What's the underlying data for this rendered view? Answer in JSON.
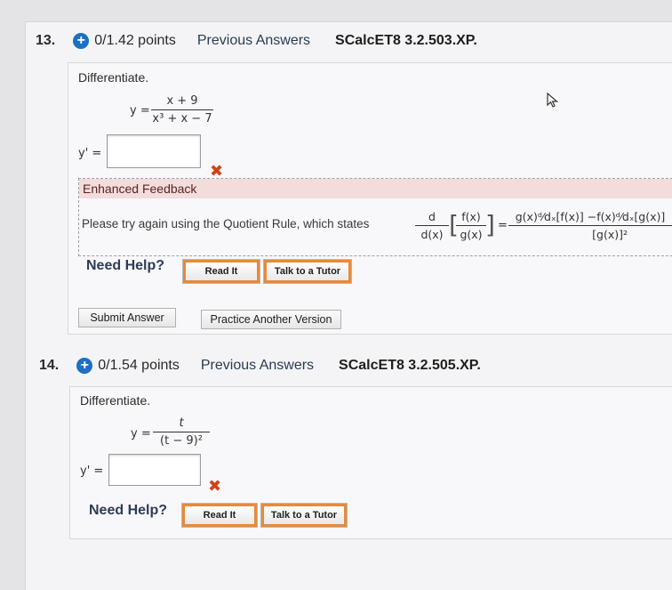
{
  "q13": {
    "number": "13.",
    "points": "0/1.42 points",
    "previous": "Previous Answers",
    "source": "SCalcET8 3.2.503.XP.",
    "instruction": "Differentiate.",
    "y_label": "y =",
    "numerator": "x + 9",
    "denominator": "x³ + x − 7",
    "yprime_label": "y' =",
    "answer": "",
    "feedback_title": "Enhanced Feedback",
    "feedback_text": "Please try again using the Quotient Rule, which states",
    "rule_lhs_num": "d",
    "rule_lhs_den": "d(x)",
    "rule_inner_num": "f(x)",
    "rule_inner_den": "g(x)",
    "rule_eq": "=",
    "rule_rhs_num": "g(x)ᵈ⁄dₓ[f(x)] −f(x)ᵈ⁄dₓ[g(x)]",
    "rule_rhs_den": "[g(x)]²",
    "need_help": "Need Help?",
    "read_it": "Read It",
    "talk_tutor": "Talk to a Tutor",
    "submit": "Submit Answer",
    "practice": "Practice Another Version"
  },
  "q14": {
    "number": "14.",
    "points": "0/1.54 points",
    "previous": "Previous Answers",
    "source": "SCalcET8 3.2.505.XP.",
    "instruction": "Differentiate.",
    "y_label": "y =",
    "numerator": "t",
    "denominator": "(t − 9)²",
    "yprime_label": "y' =",
    "answer": "",
    "need_help": "Need Help?",
    "read_it": "Read It",
    "talk_tutor": "Talk to a Tutor"
  },
  "colors": {
    "accent": "#1c6fc4",
    "error": "#d0421a",
    "help_border": "#e68a3a"
  }
}
